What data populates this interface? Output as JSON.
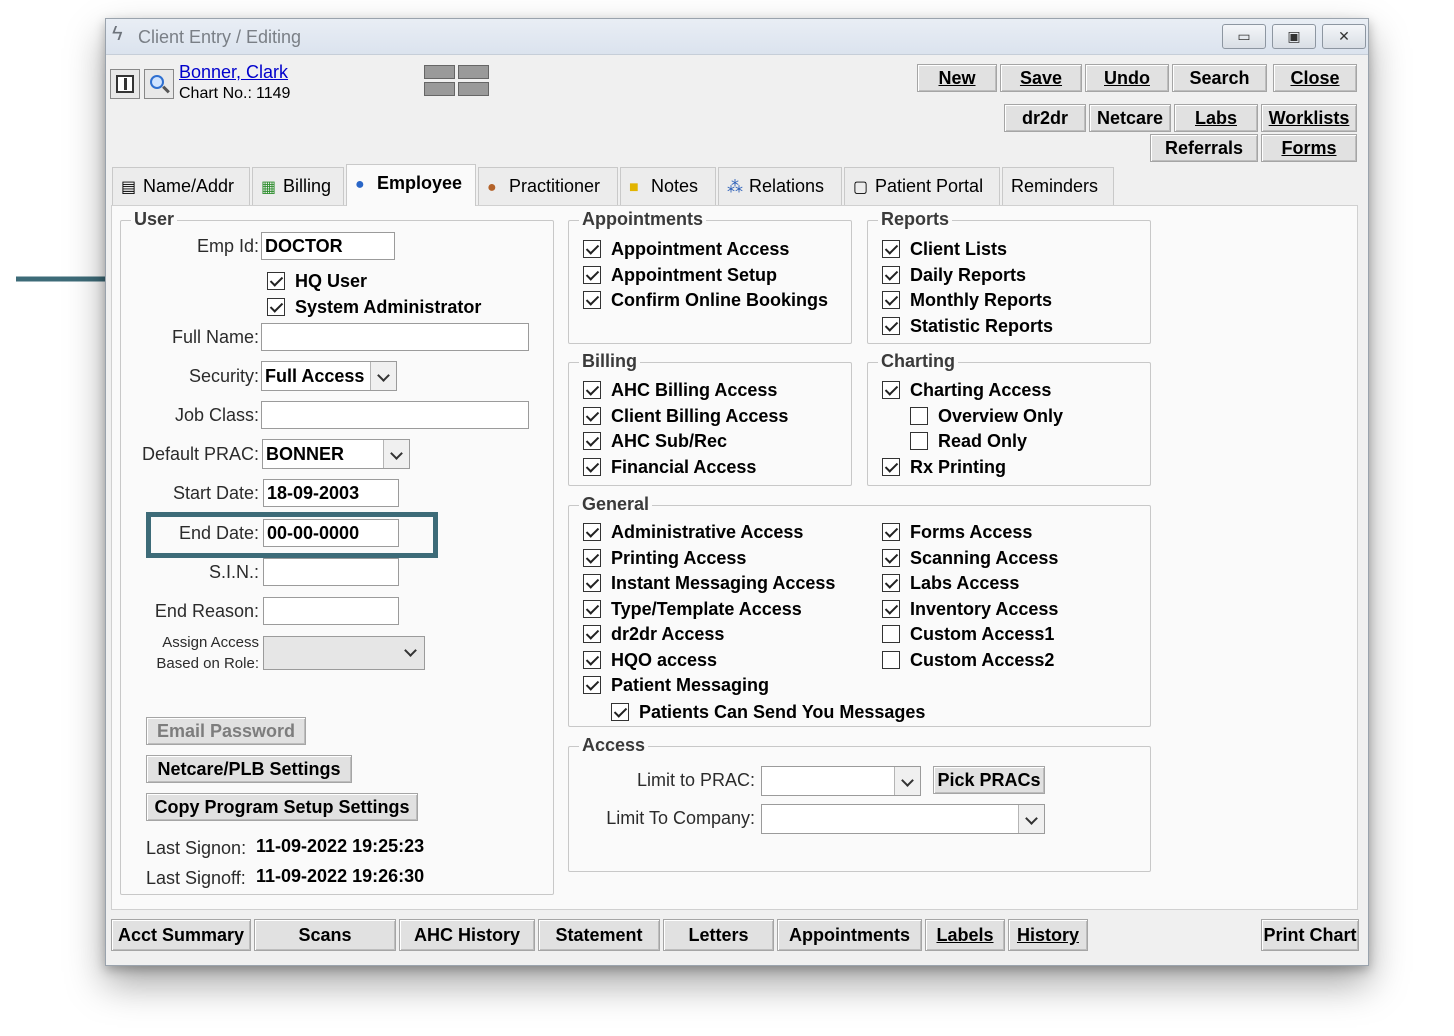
{
  "window": {
    "title": "Client Entry / Editing",
    "controls": {
      "minimize": "▭",
      "maximize": "▣",
      "close": "✕"
    }
  },
  "header": {
    "client_name": "Bonner, Clark",
    "chart_label": "Chart No.:",
    "chart_no": "1149"
  },
  "toolbar": {
    "new": "New",
    "save": "Save",
    "undo": "Undo",
    "search": "Search",
    "close": "Close",
    "dr2dr": "dr2dr",
    "netcare": "Netcare",
    "labs": "Labs",
    "worklists": "Worklists",
    "referrals": "Referrals",
    "forms": "Forms"
  },
  "tabs": [
    {
      "label": "Name/Addr",
      "icon": "id-card-icon"
    },
    {
      "label": "Billing",
      "icon": "ledger-icon"
    },
    {
      "label": "Employee",
      "icon": "person-icon"
    },
    {
      "label": "Practitioner",
      "icon": "doctor-icon"
    },
    {
      "label": "Notes",
      "icon": "note-icon"
    },
    {
      "label": "Relations",
      "icon": "tree-icon"
    },
    {
      "label": "Patient Portal",
      "icon": "portal-icon"
    },
    {
      "label": "Reminders",
      "icon": ""
    }
  ],
  "user": {
    "legend": "User",
    "emp_id_label": "Emp Id:",
    "emp_id": "DOCTOR",
    "hq_user": "HQ User",
    "hq_user_checked": true,
    "sysadmin": "System Administrator",
    "sysadmin_checked": true,
    "full_name_label": "Full Name:",
    "full_name": "",
    "security_label": "Security:",
    "security": "Full Access",
    "job_class_label": "Job Class:",
    "job_class": "",
    "default_prac_label": "Default PRAC:",
    "default_prac": "BONNER",
    "start_date_label": "Start Date:",
    "start_date": "18-09-2003",
    "end_date_label": "End Date:",
    "end_date": "00-00-0000",
    "sin_label": "S.I.N.:",
    "sin": "",
    "end_reason_label": "End Reason:",
    "end_reason": "",
    "assign_access_label_1": "Assign Access",
    "assign_access_label_2": "Based on Role:",
    "assign_access": "",
    "email_password": "Email Password",
    "netcare_plb": "Netcare/PLB Settings",
    "copy_setup": "Copy Program Setup Settings",
    "last_signon_label": "Last Signon:",
    "last_signon": "11-09-2022 19:25:23",
    "last_signoff_label": "Last Signoff:",
    "last_signoff": "11-09-2022 19:26:30"
  },
  "appointments": {
    "legend": "Appointments",
    "items": [
      {
        "label": "Appointment Access",
        "checked": true
      },
      {
        "label": "Appointment Setup",
        "checked": true
      },
      {
        "label": "Confirm Online Bookings",
        "checked": true
      }
    ]
  },
  "reports": {
    "legend": "Reports",
    "items": [
      {
        "label": "Client Lists",
        "checked": true
      },
      {
        "label": "Daily Reports",
        "checked": true
      },
      {
        "label": "Monthly Reports",
        "checked": true
      },
      {
        "label": "Statistic Reports",
        "checked": true
      }
    ]
  },
  "billing": {
    "legend": "Billing",
    "items": [
      {
        "label": "AHC Billing Access",
        "checked": true
      },
      {
        "label": "Client Billing Access",
        "checked": true
      },
      {
        "label": "AHC Sub/Rec",
        "checked": true
      },
      {
        "label": "Financial Access",
        "checked": true
      }
    ]
  },
  "charting": {
    "legend": "Charting",
    "items": [
      {
        "label": "Charting Access",
        "checked": true
      },
      {
        "label": "Overview Only",
        "checked": false
      },
      {
        "label": "Read Only",
        "checked": false
      },
      {
        "label": "Rx Printing",
        "checked": true
      }
    ]
  },
  "general": {
    "legend": "General",
    "left": [
      {
        "label": "Administrative Access",
        "checked": true
      },
      {
        "label": "Printing Access",
        "checked": true
      },
      {
        "label": "Instant Messaging Access",
        "checked": true
      },
      {
        "label": "Type/Template Access",
        "checked": true
      },
      {
        "label": "dr2dr Access",
        "checked": true
      },
      {
        "label": "HQO access",
        "checked": true
      },
      {
        "label": "Patient Messaging",
        "checked": true
      },
      {
        "label": "Patients Can Send You Messages",
        "checked": true
      }
    ],
    "right": [
      {
        "label": "Forms Access",
        "checked": true
      },
      {
        "label": "Scanning Access",
        "checked": true
      },
      {
        "label": "Labs Access",
        "checked": true
      },
      {
        "label": "Inventory Access",
        "checked": true
      },
      {
        "label": "Custom Access1",
        "checked": false
      },
      {
        "label": "Custom Access2",
        "checked": false
      }
    ]
  },
  "access": {
    "legend": "Access",
    "limit_prac_label": "Limit to PRAC:",
    "limit_prac": "",
    "pick_pracs": "Pick PRACs",
    "limit_company_label": "Limit To Company:",
    "limit_company": ""
  },
  "footer": {
    "acct_summary": "Acct Summary",
    "scans": "Scans",
    "ahc_history": "AHC History",
    "statement": "Statement",
    "letters": "Letters",
    "appointments": "Appointments",
    "labels": "Labels",
    "history": "History",
    "print_chart": "Print Chart"
  },
  "colors": {
    "annotation": "#3d6b78",
    "link": "#0000cc"
  }
}
